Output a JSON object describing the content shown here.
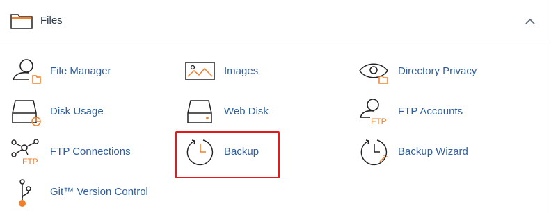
{
  "section": {
    "title": "Files",
    "icons": {
      "section": "folder-icon",
      "toggle": "chevron-up-icon"
    }
  },
  "items": [
    {
      "label": "File Manager",
      "icon": "file-manager-icon"
    },
    {
      "label": "Images",
      "icon": "images-icon"
    },
    {
      "label": "Directory Privacy",
      "icon": "directory-privacy-icon"
    },
    {
      "label": "Disk Usage",
      "icon": "disk-usage-icon"
    },
    {
      "label": "Web Disk",
      "icon": "web-disk-icon"
    },
    {
      "label": "FTP Accounts",
      "icon": "ftp-accounts-icon",
      "badge": "FTP"
    },
    {
      "label": "FTP Connections",
      "icon": "ftp-connections-icon",
      "badge": "FTP"
    },
    {
      "label": "Backup",
      "icon": "backup-icon",
      "highlighted": true
    },
    {
      "label": "Backup Wizard",
      "icon": "backup-wizard-icon"
    },
    {
      "label": "Git™ Version Control",
      "icon": "git-icon"
    }
  ],
  "colors": {
    "link": "#2f5f9f",
    "icon_stroke": "#222222",
    "accent": "#f07f2c",
    "highlight_border": "#e8171a"
  }
}
